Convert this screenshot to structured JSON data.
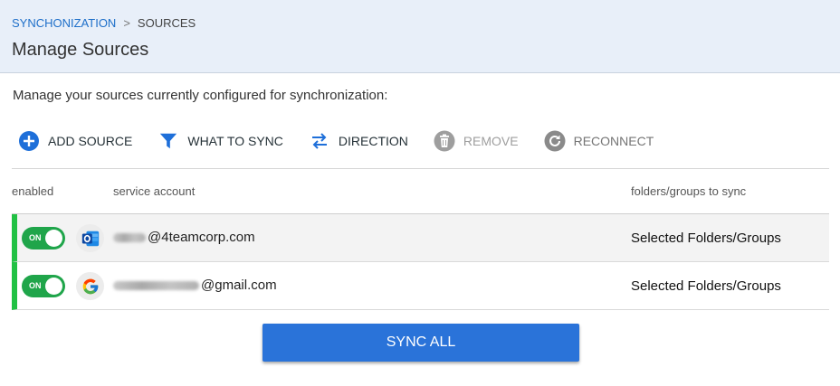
{
  "breadcrumb": {
    "parent": "SYNCHONIZATION",
    "separator": ">",
    "current": "SOURCES"
  },
  "page_title": "Manage Sources",
  "intro": "Manage your sources currently configured for synchronization:",
  "toolbar": {
    "add_source": "ADD SOURCE",
    "what_to_sync": "WHAT TO SYNC",
    "direction": "DIRECTION",
    "remove": "REMOVE",
    "reconnect": "RECONNECT"
  },
  "table": {
    "headers": {
      "enabled": "enabled",
      "service_account": "service account",
      "folders": "folders/groups to sync"
    },
    "rows": [
      {
        "toggle": "ON",
        "service": "outlook-icon",
        "account": "@4teamcorp.com",
        "folders": "Selected Folders/Groups"
      },
      {
        "toggle": "ON",
        "service": "google-icon",
        "account": "@gmail.com",
        "folders": "Selected Folders/Groups"
      }
    ]
  },
  "sync_all": "SYNC ALL",
  "colors": {
    "accent": "#2a73d9",
    "toggle_on": "#1fa54a",
    "row_marker": "#21c144",
    "header_bg": "#e8eff9"
  }
}
